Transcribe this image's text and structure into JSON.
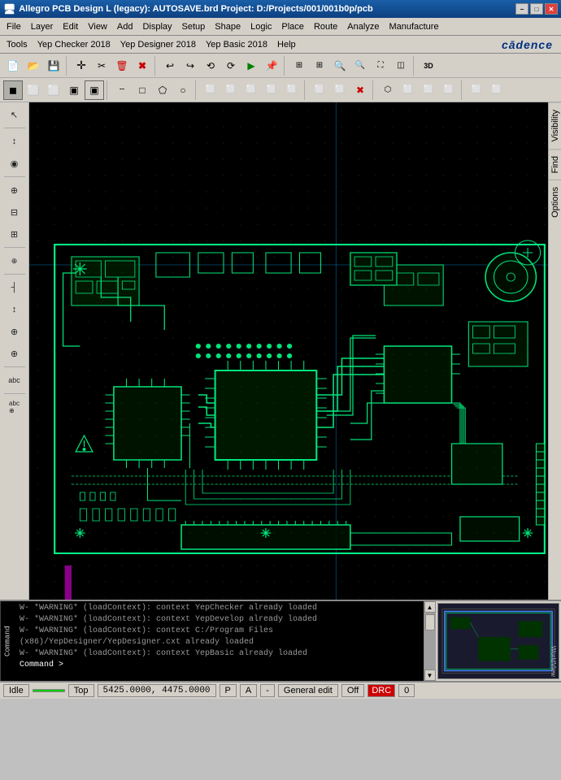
{
  "window": {
    "title": "Allegro PCB Design L (legacy): AUTOSAVE.brd  Project: D:/Projects/001/001b0p/pcb",
    "win_min": "−",
    "win_max": "□",
    "win_close": "✕"
  },
  "menus": {
    "bar1": [
      "File",
      "Layer",
      "Edit",
      "View",
      "Add",
      "Display",
      "Setup",
      "Shape",
      "Logic",
      "Place",
      "Route",
      "Analyze",
      "Manufacture"
    ],
    "bar2": [
      "Tools",
      "Yep Checker 2018",
      "Yep Designer 2018",
      "Yep Basic 2018",
      "Help"
    ],
    "cadence_logo": "cādence"
  },
  "toolbar1": {
    "buttons": [
      "📄",
      "📂",
      "💾",
      "✂",
      "🗑",
      "✖",
      "↩",
      "↪",
      "⟲",
      "⟳",
      "▶",
      "📌",
      "🔧",
      "📊",
      "📊",
      "🔍",
      "🔍",
      "🔍",
      "🔍",
      "🔍",
      "🔍",
      "3D"
    ]
  },
  "toolbar2": {
    "buttons": [
      "▣",
      "⬜",
      "⬜",
      "⬜",
      "▣",
      "▣",
      "╌",
      "⬜",
      "⬜",
      "⬜",
      "⬜",
      "⬜",
      "⬜",
      "⬜",
      "⬜",
      "⬜",
      "⬜",
      "⬜",
      "✖",
      "⬜",
      "⬡",
      "⬜",
      "⬜",
      "⬜",
      "⬜",
      "⬜"
    ]
  },
  "left_toolbar": {
    "buttons": [
      "↖",
      "↕",
      "◉",
      "⊕",
      "⊟",
      "⊞",
      "⊕",
      "abc",
      "🔧",
      "⊕",
      "┤",
      "↕",
      "⊕",
      "⊕",
      "⊕",
      "abc",
      "abc⊕"
    ]
  },
  "right_panel": {
    "tabs": [
      "Visibility",
      "Find",
      "Options"
    ]
  },
  "console": {
    "label": "Command",
    "lines": [
      "W- *WARNING* (loadContext): context YepChecker already loaded",
      "W- *WARNING* (loadContext): context YepDevelop already loaded",
      "W- *WARNING* (loadContext): context C:/Program Files (x86)/YepDesigner/YepDesigner.cxt already loaded",
      "W- *WARNING* (loadContext): context YepBasic already loaded",
      "Command >"
    ]
  },
  "status_bar": {
    "idle": "Idle",
    "indicator": "",
    "view": "Top",
    "coordinates": "5425.0000, 4475.0000",
    "coord_unit": "P",
    "coord_mode": "A",
    "dash": "-",
    "edit_mode": "General edit",
    "off_label": "Off",
    "drc_label": "DRC",
    "zero": "0"
  }
}
